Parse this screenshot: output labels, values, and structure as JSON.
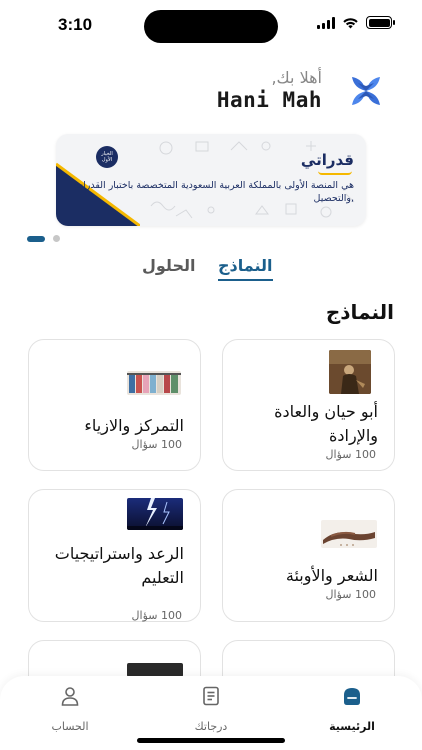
{
  "status_bar": {
    "time": "3:10"
  },
  "header": {
    "greeting": "أهلا بك,",
    "user_name": "Hani Mah"
  },
  "banner": {
    "brand": "قدراتي",
    "tagline": "هي المنصة الأولى بالمملكة العربية السعودية المتخصصة باختبار القدرات ,والتحصيل",
    "badge_text": "الخيار الأول"
  },
  "tabs": {
    "models": "النماذج",
    "solutions": "الحلول"
  },
  "section_title": "النماذج",
  "cards": [
    {
      "title": "أبو حيان والعادة والإرادة",
      "count": "100 سؤال"
    },
    {
      "title": "التمركز والازياء",
      "count": "100 سؤال"
    },
    {
      "title": "الشعر والأوبئة",
      "count": "100 سؤال"
    },
    {
      "title": "الرعد واستراتيجيات التعليم",
      "count": "100 سؤال"
    }
  ],
  "bottom_nav": [
    {
      "label": "الرئيسية",
      "icon": "home-icon",
      "active": true
    },
    {
      "label": "درجاتك",
      "icon": "grades-icon",
      "active": false
    },
    {
      "label": "الحساب",
      "icon": "account-icon",
      "active": false
    }
  ],
  "colors": {
    "accent": "#1b5f8c",
    "brand_navy": "#1b2d63",
    "logo_blue": "#3a6fd8",
    "brand_yellow": "#f5b800"
  }
}
